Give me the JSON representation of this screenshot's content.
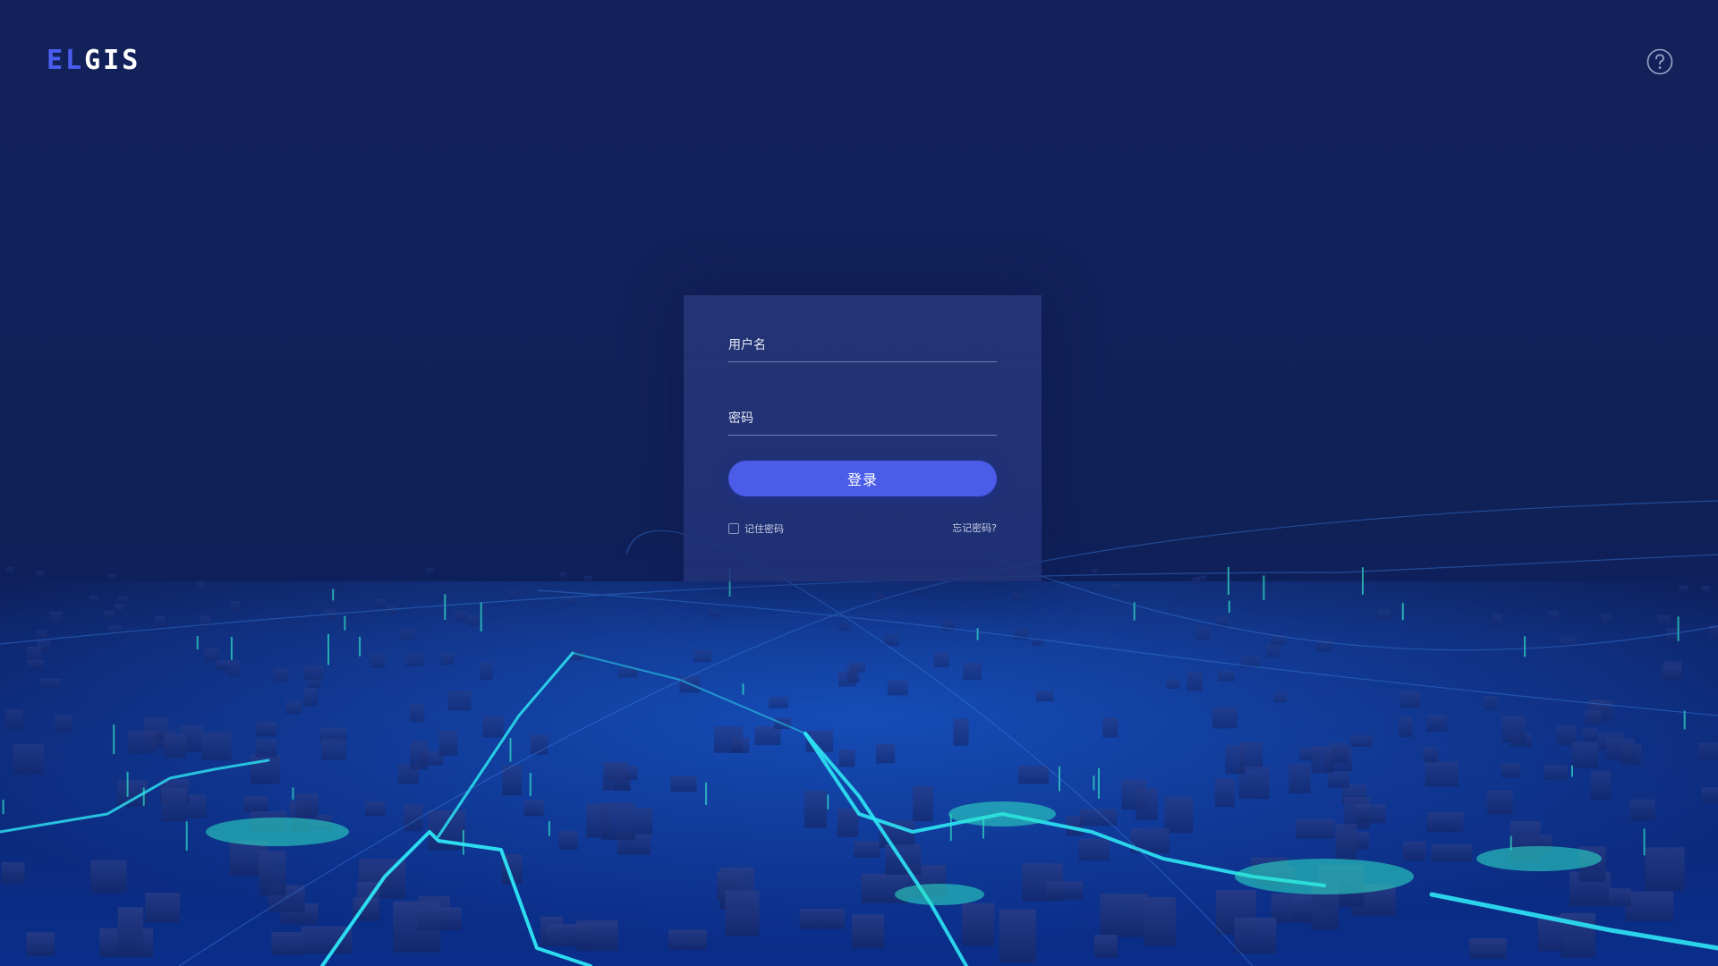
{
  "header": {
    "logo_prefix": "EL",
    "logo_suffix": "GIS",
    "help_icon": "question-circle-icon"
  },
  "login_form": {
    "username_placeholder": "用户名",
    "username_value": "",
    "password_placeholder": "密码",
    "password_value": "",
    "login_button_label": "登录",
    "remember_label": "记住密码",
    "remember_checked": false,
    "forgot_label": "忘记密码?"
  },
  "colors": {
    "background": "#12215a",
    "accent": "#4a5ce8",
    "logo_accent": "#4a5df0",
    "city_glow": "#2ee6f5"
  }
}
